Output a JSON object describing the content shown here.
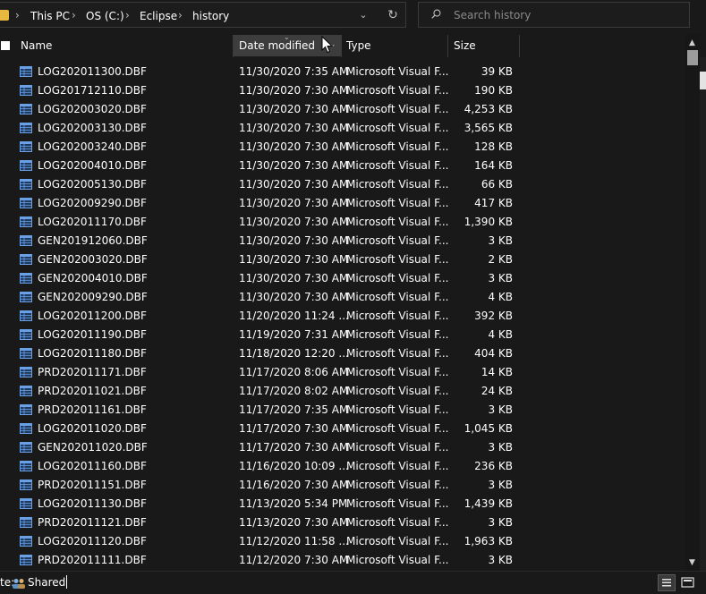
{
  "breadcrumb": [
    "This PC",
    "OS (C:)",
    "Eclipse",
    "history"
  ],
  "search": {
    "placeholder": "Search history"
  },
  "columns": {
    "name": "Name",
    "date": "Date modified",
    "type": "Type",
    "size": "Size"
  },
  "files": [
    {
      "name": "LOG202011300.DBF",
      "date": "11/30/2020 7:35 AM",
      "type": "Microsoft Visual F...",
      "size": "39 KB"
    },
    {
      "name": "LOG201712110.DBF",
      "date": "11/30/2020 7:30 AM",
      "type": "Microsoft Visual F...",
      "size": "190 KB"
    },
    {
      "name": "LOG202003020.DBF",
      "date": "11/30/2020 7:30 AM",
      "type": "Microsoft Visual F...",
      "size": "4,253 KB"
    },
    {
      "name": "LOG202003130.DBF",
      "date": "11/30/2020 7:30 AM",
      "type": "Microsoft Visual F...",
      "size": "3,565 KB"
    },
    {
      "name": "LOG202003240.DBF",
      "date": "11/30/2020 7:30 AM",
      "type": "Microsoft Visual F...",
      "size": "128 KB"
    },
    {
      "name": "LOG202004010.DBF",
      "date": "11/30/2020 7:30 AM",
      "type": "Microsoft Visual F...",
      "size": "164 KB"
    },
    {
      "name": "LOG202005130.DBF",
      "date": "11/30/2020 7:30 AM",
      "type": "Microsoft Visual F...",
      "size": "66 KB"
    },
    {
      "name": "LOG202009290.DBF",
      "date": "11/30/2020 7:30 AM",
      "type": "Microsoft Visual F...",
      "size": "417 KB"
    },
    {
      "name": "LOG202011170.DBF",
      "date": "11/30/2020 7:30 AM",
      "type": "Microsoft Visual F...",
      "size": "1,390 KB"
    },
    {
      "name": "GEN201912060.DBF",
      "date": "11/30/2020 7:30 AM",
      "type": "Microsoft Visual F...",
      "size": "3 KB"
    },
    {
      "name": "GEN202003020.DBF",
      "date": "11/30/2020 7:30 AM",
      "type": "Microsoft Visual F...",
      "size": "2 KB"
    },
    {
      "name": "GEN202004010.DBF",
      "date": "11/30/2020 7:30 AM",
      "type": "Microsoft Visual F...",
      "size": "3 KB"
    },
    {
      "name": "GEN202009290.DBF",
      "date": "11/30/2020 7:30 AM",
      "type": "Microsoft Visual F...",
      "size": "4 KB"
    },
    {
      "name": "LOG202011200.DBF",
      "date": "11/20/2020 11:24 ...",
      "type": "Microsoft Visual F...",
      "size": "392 KB"
    },
    {
      "name": "LOG202011190.DBF",
      "date": "11/19/2020 7:31 AM",
      "type": "Microsoft Visual F...",
      "size": "4 KB"
    },
    {
      "name": "LOG202011180.DBF",
      "date": "11/18/2020 12:20 ...",
      "type": "Microsoft Visual F...",
      "size": "404 KB"
    },
    {
      "name": "PRD202011171.DBF",
      "date": "11/17/2020 8:06 AM",
      "type": "Microsoft Visual F...",
      "size": "14 KB"
    },
    {
      "name": "PRD202011021.DBF",
      "date": "11/17/2020 8:02 AM",
      "type": "Microsoft Visual F...",
      "size": "24 KB"
    },
    {
      "name": "PRD202011161.DBF",
      "date": "11/17/2020 7:35 AM",
      "type": "Microsoft Visual F...",
      "size": "3 KB"
    },
    {
      "name": "LOG202011020.DBF",
      "date": "11/17/2020 7:30 AM",
      "type": "Microsoft Visual F...",
      "size": "1,045 KB"
    },
    {
      "name": "GEN202011020.DBF",
      "date": "11/17/2020 7:30 AM",
      "type": "Microsoft Visual F...",
      "size": "3 KB"
    },
    {
      "name": "LOG202011160.DBF",
      "date": "11/16/2020 10:09 ...",
      "type": "Microsoft Visual F...",
      "size": "236 KB"
    },
    {
      "name": "PRD202011151.DBF",
      "date": "11/16/2020 7:30 AM",
      "type": "Microsoft Visual F...",
      "size": "3 KB"
    },
    {
      "name": "LOG202011130.DBF",
      "date": "11/13/2020 5:34 PM",
      "type": "Microsoft Visual F...",
      "size": "1,439 KB"
    },
    {
      "name": "PRD202011121.DBF",
      "date": "11/13/2020 7:30 AM",
      "type": "Microsoft Visual F...",
      "size": "3 KB"
    },
    {
      "name": "LOG202011120.DBF",
      "date": "11/12/2020 11:58 ...",
      "type": "Microsoft Visual F...",
      "size": "1,963 KB"
    },
    {
      "name": "PRD202011111.DBF",
      "date": "11/12/2020 7:30 AM",
      "type": "Microsoft Visual F...",
      "size": "3 KB"
    }
  ],
  "status": {
    "text": "te: ",
    "shared": "Shared"
  },
  "icons": {
    "file": "dbf-file-icon",
    "folder": "folder-icon",
    "search": "search-icon",
    "refresh": "refresh-icon",
    "dropdown": "chevron-down-icon"
  },
  "colors": {
    "background": "#191919",
    "text": "#ffffff",
    "header_selected": "#3d3d3d",
    "file_icon": "#6aa0e6",
    "folder": "#e8b740"
  }
}
